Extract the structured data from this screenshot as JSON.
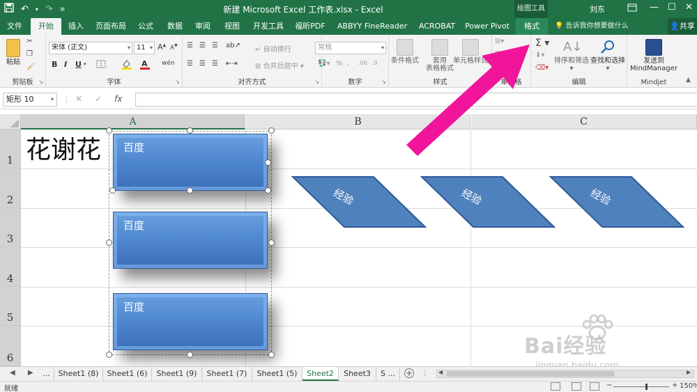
{
  "title_bar": {
    "title": "新建 Microsoft Excel 工作表.xlsx  -  Excel",
    "context_tools": "绘图工具",
    "user": "刘东",
    "qat": {
      "save_icon": "save-icon",
      "undo_icon": "undo-icon",
      "redo_icon": "redo-icon",
      "customize_icon": "customize-icon"
    }
  },
  "tabs": [
    {
      "label": "文件"
    },
    {
      "label": "开始"
    },
    {
      "label": "插入"
    },
    {
      "label": "页面布局"
    },
    {
      "label": "公式"
    },
    {
      "label": "数据"
    },
    {
      "label": "审阅"
    },
    {
      "label": "视图"
    },
    {
      "label": "开发工具"
    },
    {
      "label": "福昕PDF"
    },
    {
      "label": "ABBYY FineReader 12"
    },
    {
      "label": "ACROBAT"
    },
    {
      "label": "Power Pivot"
    },
    {
      "label": "格式"
    }
  ],
  "tell_me": "告诉我你想要做什么",
  "share": "共享",
  "ribbon": {
    "clipboard": {
      "label": "剪贴板",
      "paste": "粘贴"
    },
    "font": {
      "label": "字体",
      "font_name": "宋体 (正文)",
      "font_size": "11",
      "bold": "B",
      "italic": "I",
      "underline": "U",
      "grow": "A",
      "shrink": "A",
      "wen": "wén"
    },
    "alignment": {
      "label": "对齐方式",
      "wrap": "自动换行",
      "merge": "合并后居中"
    },
    "number": {
      "label": "数字",
      "format": "常规",
      "percent": "%",
      "comma": ","
    },
    "styles": {
      "label": "样式",
      "conditional": "条件格式",
      "table_format_1": "套用",
      "table_format_2": "表格格式",
      "cell_styles": "单元格样式"
    },
    "cells": {
      "label": "单元格",
      "format": "格式"
    },
    "editing": {
      "label": "编辑",
      "sort": "排序和筛选",
      "find": "查找和选择",
      "sigma": "Σ"
    },
    "mindjet": {
      "label": "Mindjet",
      "send_1": "发送到",
      "send_2": "MindManager"
    }
  },
  "formula_bar": {
    "name_box": "矩形 10",
    "cancel": "✕",
    "enter": "✓",
    "fx": "fx",
    "value": ""
  },
  "columns": [
    "A",
    "B",
    "C"
  ],
  "rows": [
    "1",
    "2",
    "3",
    "4",
    "5",
    "6"
  ],
  "cells": {
    "A1": "花谢花"
  },
  "shapes": {
    "rectangles": [
      {
        "label": "百度"
      },
      {
        "label": "百度"
      },
      {
        "label": "百度"
      }
    ],
    "parallelograms": [
      {
        "label": "经验"
      },
      {
        "label": "经验"
      },
      {
        "label": "经验"
      }
    ]
  },
  "annotation": {
    "arrow_color": "#f0159a"
  },
  "sheets": [
    {
      "label": "..."
    },
    {
      "label": "Sheet1 (8)"
    },
    {
      "label": "Sheet1 (6)"
    },
    {
      "label": "Sheet1 (9)"
    },
    {
      "label": "Sheet1 (7)"
    },
    {
      "label": "Sheet1 (5)"
    },
    {
      "label": "Sheet2"
    },
    {
      "label": "Sheet3"
    },
    {
      "label": "S ..."
    }
  ],
  "status": {
    "ready": "就绪",
    "zoom": "150%",
    "zoom_minus": "−",
    "zoom_plus": "+"
  },
  "watermark": {
    "text": "Bai经验",
    "url": "jingyan.baidu.com"
  },
  "colors": {
    "excel_green": "#217346",
    "shape_blue": "#4f81bd"
  }
}
